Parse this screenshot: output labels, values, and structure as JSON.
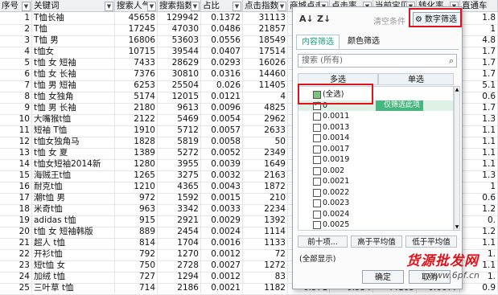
{
  "columns": [
    {
      "label": "序号",
      "dd": true
    },
    {
      "label": "关键词",
      "dd": true
    },
    {
      "label": "搜索人气",
      "dd": true
    },
    {
      "label": "搜索指数",
      "dd": true
    },
    {
      "label": "占比",
      "dd": true
    },
    {
      "label": "点击指数",
      "dd": true
    },
    {
      "label": "商城点击",
      "dd": true
    },
    {
      "label": "点击率",
      "dd": true
    },
    {
      "label": "当前宝贝",
      "dd": true
    },
    {
      "label": "转化率",
      "dd": true
    },
    {
      "label": "直通车",
      "dd": false
    }
  ],
  "rows": [
    [
      "1",
      "T恤长袖",
      "45658",
      "129942",
      "0.1372",
      "31113",
      "",
      "",
      "",
      "",
      "1.8"
    ],
    [
      "2",
      "T恤",
      "17245",
      "47030",
      "0.0486",
      "21857",
      "",
      "",
      "",
      "",
      "1"
    ],
    [
      "3",
      "T恤 男",
      "16806",
      "53603",
      "0.0556",
      "18549",
      "",
      "",
      "",
      "",
      "4.8"
    ],
    [
      "4",
      "t恤女",
      "10715",
      "39544",
      "0.0407",
      "17514",
      "",
      "",
      "",
      "",
      "1.7"
    ],
    [
      "5",
      "t恤 女 短袖",
      "7433",
      "28629",
      "0.0293",
      "16026",
      "",
      "",
      "",
      "",
      "1.7"
    ],
    [
      "6",
      "t恤 女 长袖",
      "7376",
      "30810",
      "0.0316",
      "14460",
      "",
      "",
      "",
      "",
      "1.7"
    ],
    [
      "7",
      "t恤 男 短袖",
      "6253",
      "25504",
      "0.026",
      "11405",
      "",
      "",
      "",
      "",
      "5.1"
    ],
    [
      "8",
      "t恤 女独角",
      "5174",
      "12015",
      "0.0121",
      "4",
      "",
      "",
      "",
      "",
      "0.6"
    ],
    [
      "9",
      "t恤 男 长袖",
      "2180",
      "9613",
      "0.0096",
      "4825",
      "",
      "",
      "",
      "",
      "1.7"
    ],
    [
      "10",
      "大嘴猴t恤",
      "2122",
      "5469",
      "0.0054",
      "2962",
      "",
      "",
      "",
      "",
      "1.3"
    ],
    [
      "11",
      "短袖 T恤",
      "1910",
      "5712",
      "0.0057",
      "2633",
      "",
      "",
      "",
      "",
      "1.1"
    ],
    [
      "12",
      "t恤女独角马",
      "1828",
      "5819",
      "0.0058",
      "50",
      "",
      "",
      "",
      "",
      "1.1"
    ],
    [
      "13",
      "t恤 女 夏",
      "1389",
      "5272",
      "0.0052",
      "2349",
      "",
      "",
      "",
      "",
      "1.1"
    ],
    [
      "14",
      "t恤女短袖2014新",
      "1280",
      "3955",
      "0.0039",
      "1649",
      "",
      "",
      "",
      "",
      "1.1"
    ],
    [
      "15",
      "海贼王t恤",
      "1265",
      "3275",
      "0.0032",
      "2163",
      "",
      "",
      "",
      "",
      "1.3"
    ],
    [
      "16",
      "耐克t恤",
      "1210",
      "4365",
      "0.0043",
      "1872",
      "",
      "",
      "",
      "",
      "1"
    ],
    [
      "17",
      "潮t恤 男",
      "972",
      "1592",
      "0.0015",
      "210",
      "",
      "",
      "",
      "",
      "0.6"
    ],
    [
      "18",
      "米奇t恤",
      "963",
      "3342",
      "0.0033",
      "2234",
      "",
      "",
      "",
      "",
      "1.2"
    ],
    [
      "19",
      "adidas t恤",
      "915",
      "2921",
      "0.0029",
      "1392",
      "",
      "",
      "",
      "",
      "0."
    ],
    [
      "20",
      "t恤 女 短袖韩版",
      "889",
      "2454",
      "0.0024",
      "1114",
      "",
      "",
      "",
      "",
      "1.2"
    ],
    [
      "21",
      "超人 t恤",
      "814",
      "1704",
      "0.0016",
      "1133",
      "",
      "",
      "",
      "",
      "1.1"
    ],
    [
      "22",
      "开衫t恤",
      "792",
      "1270",
      "0.0012",
      "72",
      "",
      "",
      "",
      "",
      "1."
    ],
    [
      "23",
      "短t恤 女",
      "750",
      "2728",
      "0.0027",
      "1272",
      "",
      "",
      "",
      "",
      "1.1"
    ],
    [
      "24",
      "加绒 t恤",
      "727",
      "1294",
      "0.0012",
      "83",
      "",
      "",
      "",
      "",
      "1."
    ],
    [
      "25",
      "三叶草 t恤",
      "714",
      "2186",
      "0.0021",
      "1182",
      "0.571",
      "0.534",
      "44165",
      "0.0077",
      "0.9"
    ]
  ],
  "panel": {
    "sort_asc": "A↓",
    "sort_desc": "Z↓",
    "clear_label": "清空条件",
    "number_filter_label": "数字筛选",
    "tab_content": "内容筛选",
    "tab_color": "颜色筛选",
    "search_placeholder": "搜索 (所有)",
    "col_multi": "多选",
    "col_single": "单选",
    "items": [
      {
        "label": "(全选)",
        "state": "partial"
      },
      {
        "label": "0",
        "state": "on"
      },
      {
        "label": "0.0011",
        "state": "off"
      },
      {
        "label": "0.0013",
        "state": "off"
      },
      {
        "label": "0.0014",
        "state": "off"
      },
      {
        "label": "0.0017",
        "state": "off"
      },
      {
        "label": "0.0019",
        "state": "off"
      },
      {
        "label": "0.002",
        "state": "off"
      },
      {
        "label": "0.0021",
        "state": "off"
      },
      {
        "label": "0.0022",
        "state": "off"
      },
      {
        "label": "0.0023",
        "state": "off"
      },
      {
        "label": "0.0024",
        "state": "off"
      },
      {
        "label": "0.0025",
        "state": "off"
      }
    ],
    "only_item_label": "仅筛选此项",
    "btn_top10": "前十项...",
    "btn_above_avg": "高于平均值",
    "btn_below_avg": "低于平均值",
    "show_all": "(全部显示)",
    "ok_label": "确定",
    "cancel_label": "取消"
  },
  "watermark": {
    "main": "货源批发网",
    "sub": "www.6pf.cn"
  },
  "colors": {
    "highlight": "#e0121a",
    "accent": "#16a37a"
  }
}
